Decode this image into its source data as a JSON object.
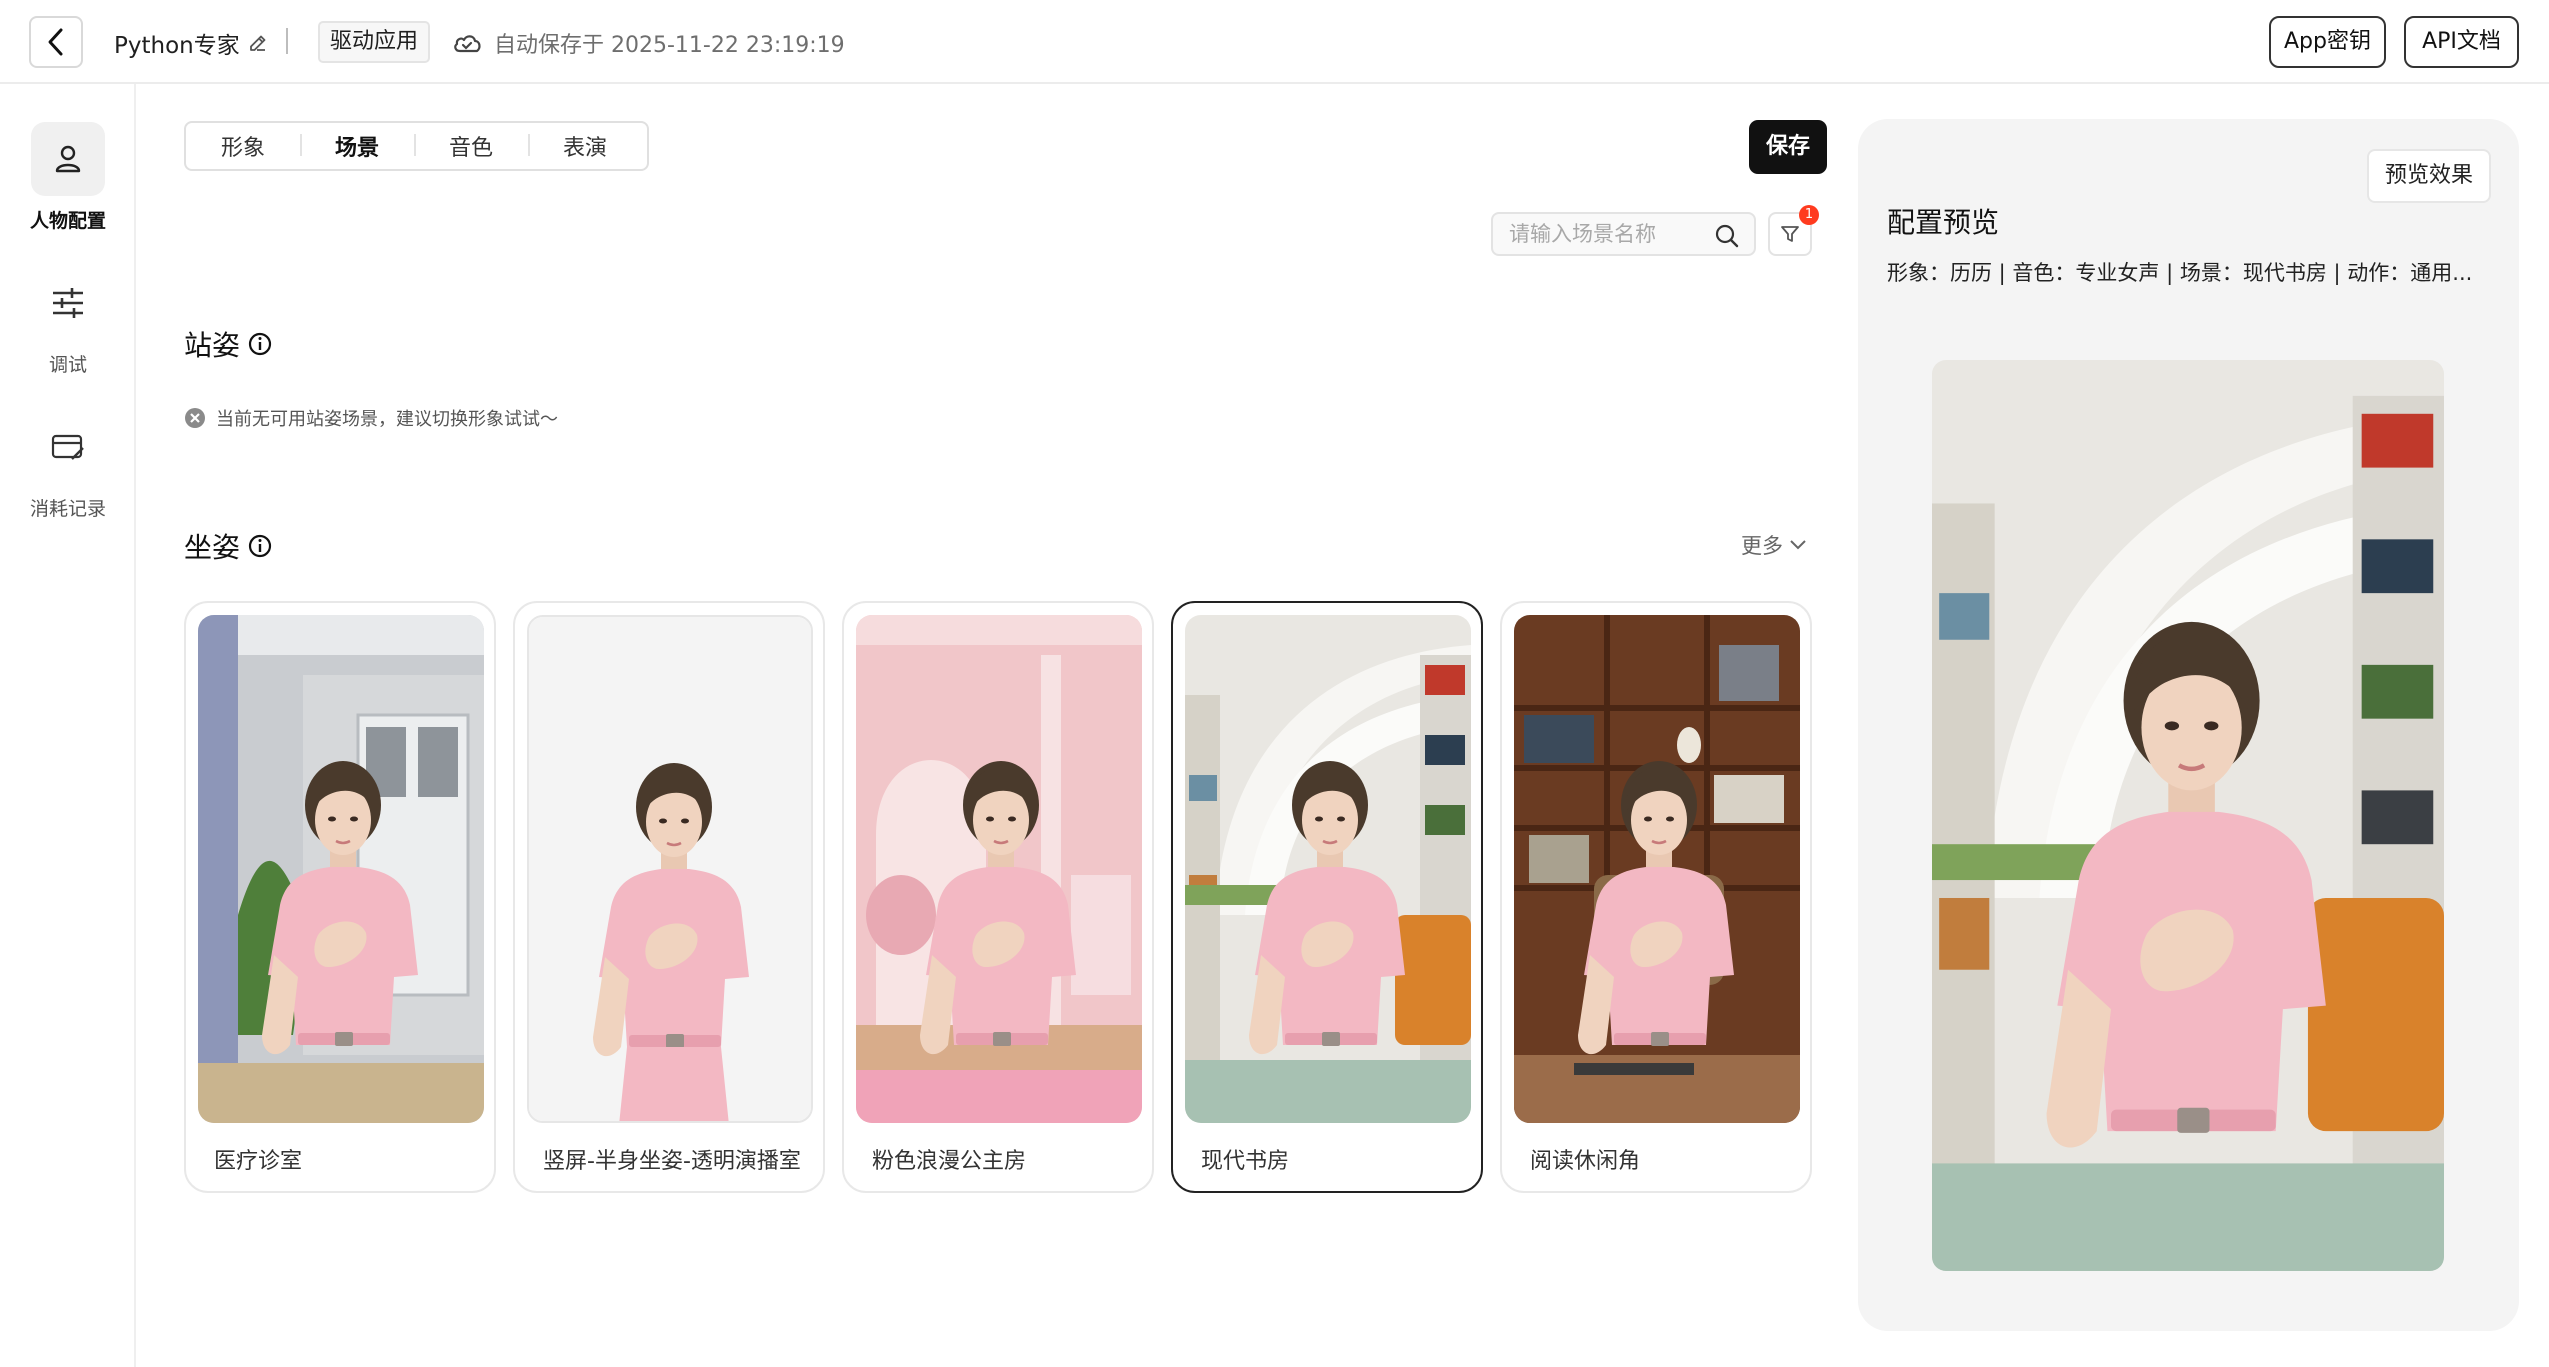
{
  "header": {
    "project_name": "Python专家",
    "app_tag": "驱动应用",
    "autosave_text": "自动保存于 2025-11-22 23:19:19",
    "app_key_label": "App密钥",
    "api_doc_label": "API文档"
  },
  "sidebar": {
    "items": [
      {
        "label": "人物配置",
        "icon": "person-icon",
        "active": true
      },
      {
        "label": "调试",
        "icon": "sliders-icon",
        "active": false
      },
      {
        "label": "消耗记录",
        "icon": "billing-icon",
        "active": false
      }
    ]
  },
  "tabs": [
    {
      "label": "形象",
      "active": false
    },
    {
      "label": "场景",
      "active": true
    },
    {
      "label": "音色",
      "active": false
    },
    {
      "label": "表演",
      "active": false
    }
  ],
  "save_label": "保存",
  "search": {
    "placeholder": "请输入场景名称"
  },
  "filter_badge": "1",
  "standing": {
    "title": "站姿",
    "empty_text": "当前无可用站姿场景，建议切换形象试试～"
  },
  "sitting": {
    "title": "坐姿",
    "more_label": "更多",
    "scenes": [
      {
        "label": "医疗诊室",
        "selected": false
      },
      {
        "label": "竖屏-半身坐姿-透明演播室",
        "selected": false
      },
      {
        "label": "粉色浪漫公主房",
        "selected": false
      },
      {
        "label": "现代书房",
        "selected": true
      },
      {
        "label": "阅读休闲角",
        "selected": false
      }
    ]
  },
  "preview": {
    "button_label": "预览效果",
    "title": "配置预览",
    "summary": "形象：历历 | 音色：专业女声 | 场景：现代书房 | 动作：通用..."
  },
  "colors": {
    "accent": "#111111",
    "badge": "#ff3b1f",
    "dress": "#f3b8c3"
  }
}
